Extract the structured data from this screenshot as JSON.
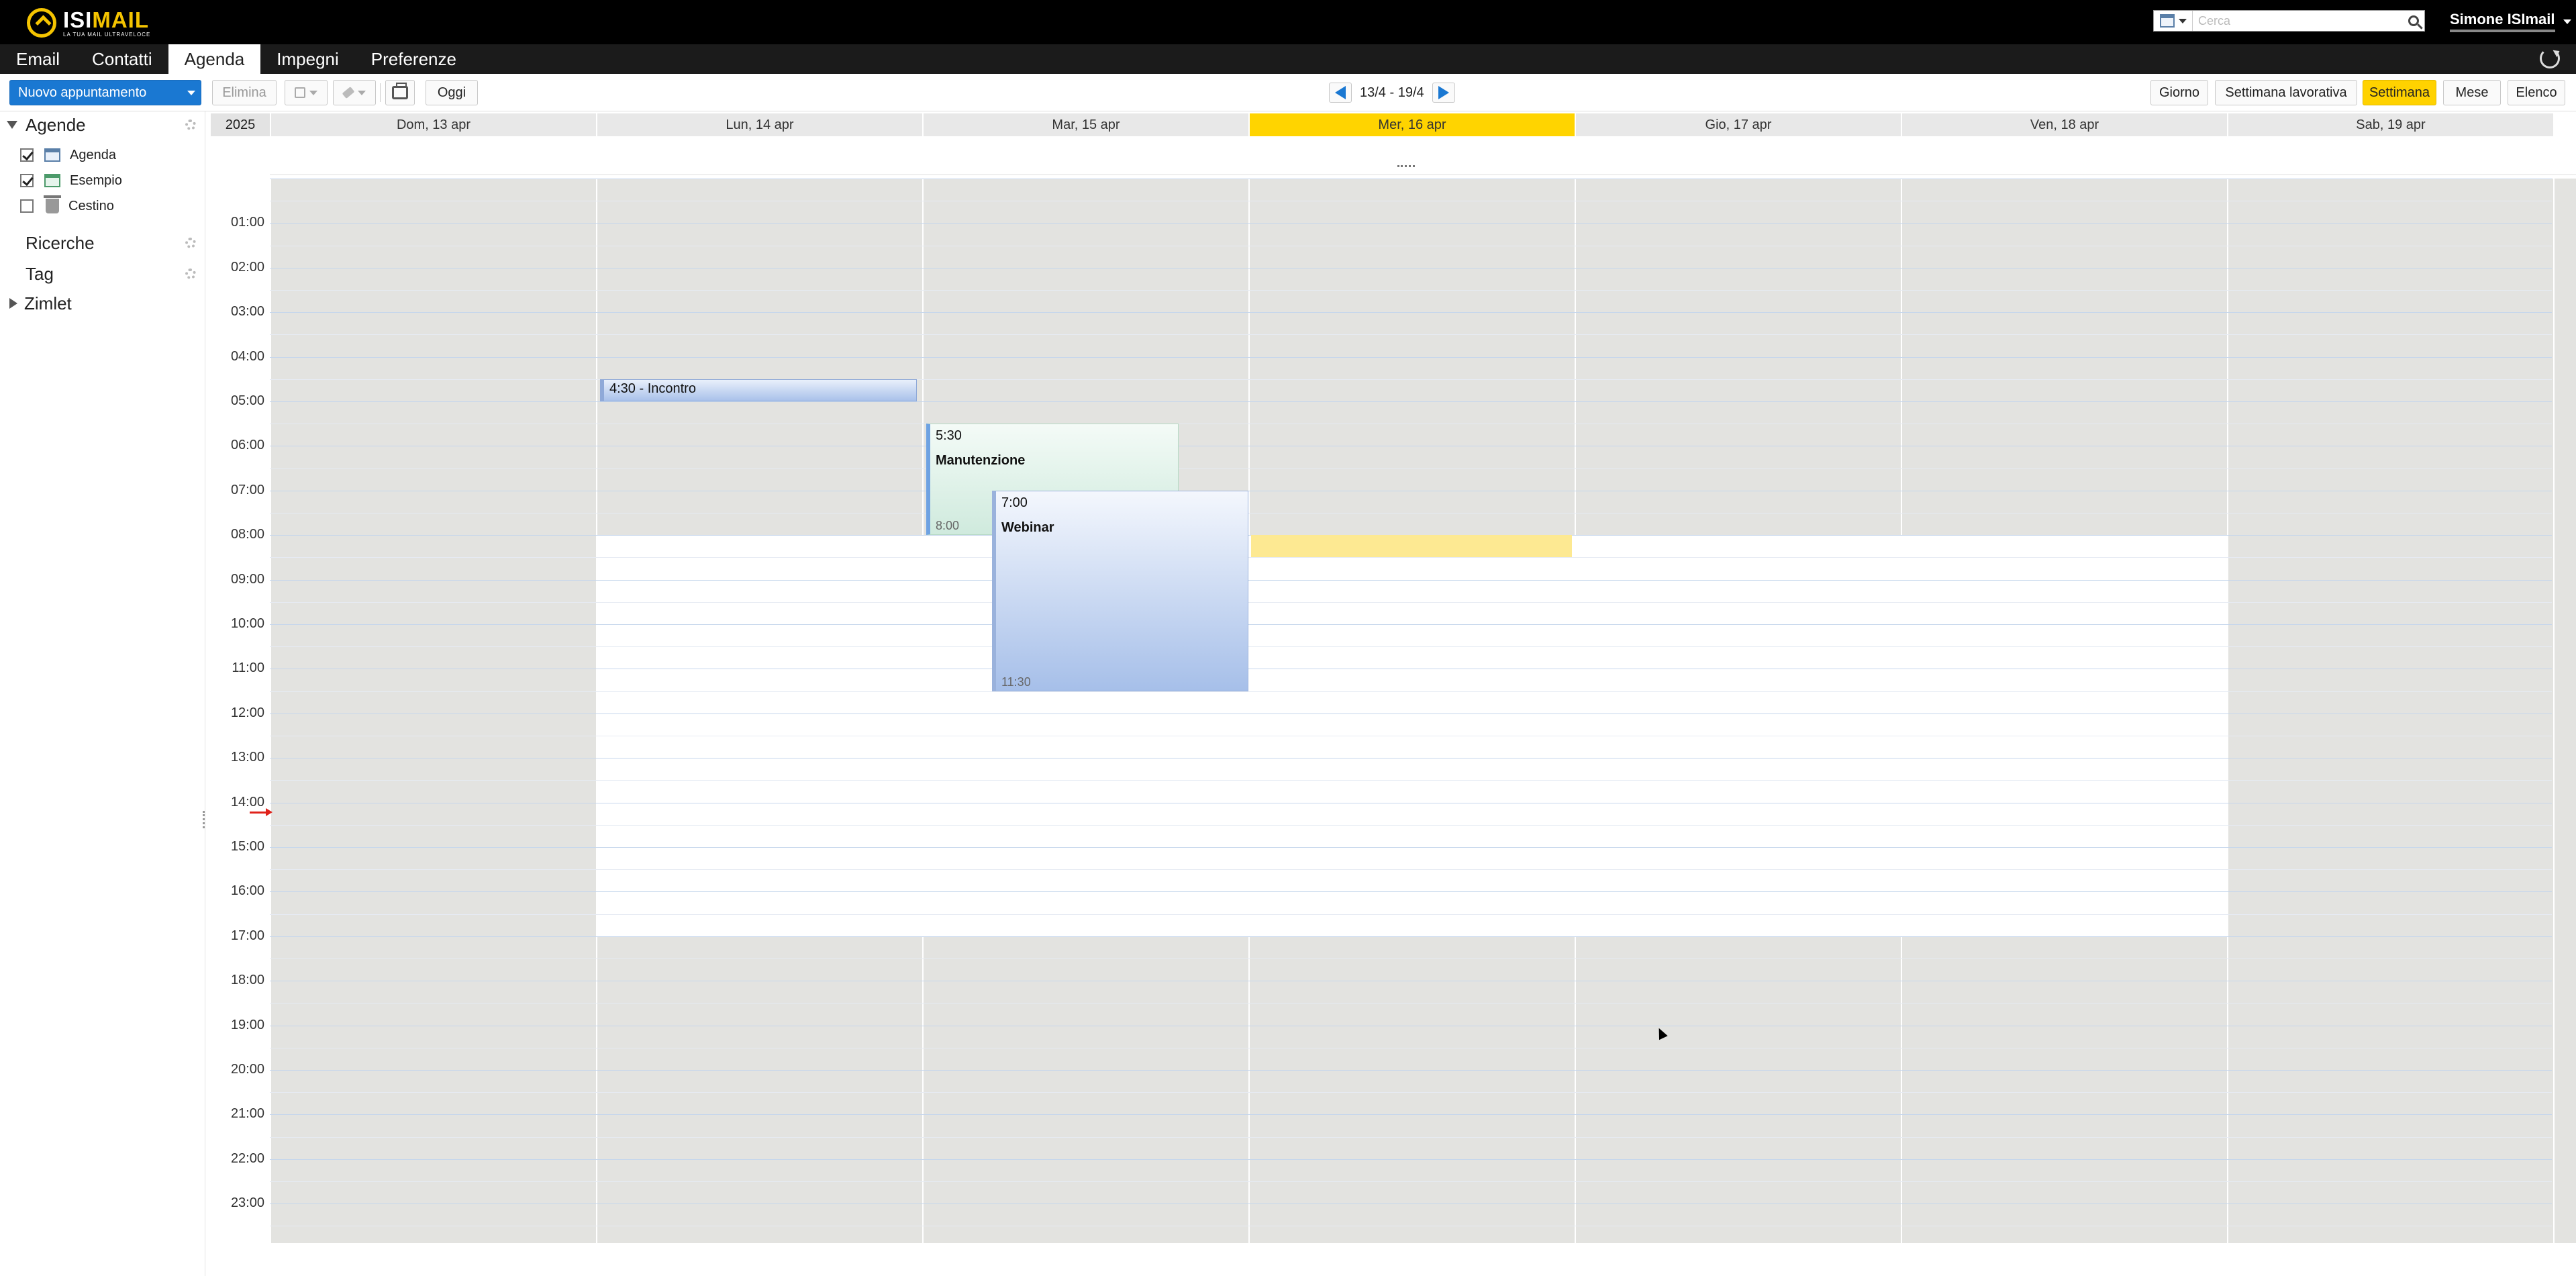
{
  "header": {
    "logo_name_a": "ISI",
    "logo_name_b": "MAIL",
    "logo_tagline": "LA TUA MAIL ULTRAVELOCE",
    "search_placeholder": "Cerca",
    "user_name": "Simone ISImail"
  },
  "app_tabs": [
    {
      "label": "Email",
      "active": false
    },
    {
      "label": "Contatti",
      "active": false
    },
    {
      "label": "Agenda",
      "active": true
    },
    {
      "label": "Impegni",
      "active": false
    },
    {
      "label": "Preferenze",
      "active": false
    }
  ],
  "toolbar": {
    "new_label": "Nuovo appuntamento",
    "delete_label": "Elimina",
    "today_label": "Oggi",
    "range_label": "13/4 - 19/4",
    "views": [
      {
        "label": "Giorno",
        "active": false
      },
      {
        "label": "Settimana lavorativa",
        "active": false
      },
      {
        "label": "Settimana",
        "active": true
      },
      {
        "label": "Mese",
        "active": false
      },
      {
        "label": "Elenco",
        "active": false
      }
    ]
  },
  "sidebar": {
    "agende_label": "Agende",
    "calendars": [
      {
        "label": "Agenda",
        "checked": true,
        "icon": "calendar-blue-icon"
      },
      {
        "label": "Esempio",
        "checked": true,
        "icon": "calendar-green-icon"
      },
      {
        "label": "Cestino",
        "checked": false,
        "icon": "trash-icon"
      }
    ],
    "ricerche_label": "Ricerche",
    "tag_label": "Tag",
    "zimlet_label": "Zimlet"
  },
  "calendar": {
    "year": "2025",
    "days": [
      {
        "label": "Dom, 13 apr",
        "today": false,
        "workday": false
      },
      {
        "label": "Lun, 14 apr",
        "today": false,
        "workday": true
      },
      {
        "label": "Mar, 15 apr",
        "today": false,
        "workday": true
      },
      {
        "label": "Mer, 16 apr",
        "today": true,
        "workday": true
      },
      {
        "label": "Gio, 17 apr",
        "today": false,
        "workday": true
      },
      {
        "label": "Ven, 18 apr",
        "today": false,
        "workday": true
      },
      {
        "label": "Sab, 19 apr",
        "today": false,
        "workday": false
      }
    ],
    "hours": [
      "01:00",
      "02:00",
      "03:00",
      "04:00",
      "05:00",
      "06:00",
      "07:00",
      "08:00",
      "09:00",
      "10:00",
      "11:00",
      "12:00",
      "13:00",
      "14:00",
      "15:00",
      "16:00",
      "17:00",
      "18:00",
      "19:00",
      "20:00",
      "21:00",
      "22:00",
      "23:00"
    ],
    "work_start": 8,
    "work_end": 17,
    "now_time": 14.2,
    "selected_slot": {
      "day": 3,
      "start": 8,
      "end": 8.5
    },
    "colors": {
      "today": "#ffd400",
      "offhours": "#e3e3e0",
      "accent": "#1a78d2"
    },
    "appointments": [
      {
        "id": "appt-incontro",
        "day": 1,
        "start": 4.5,
        "end": 5,
        "time_label": "4:30 - Incontro",
        "title": "",
        "end_label": ""
      },
      {
        "id": "appt-manut",
        "day": 2,
        "start": 5.5,
        "end": 8,
        "time_label": "5:30",
        "title": "Manutenzione",
        "end_label": "8:00"
      },
      {
        "id": "appt-webinar",
        "day": 2,
        "start": 7,
        "end": 11.5,
        "time_label": "7:00",
        "title": "Webinar",
        "end_label": "11:30"
      }
    ]
  }
}
